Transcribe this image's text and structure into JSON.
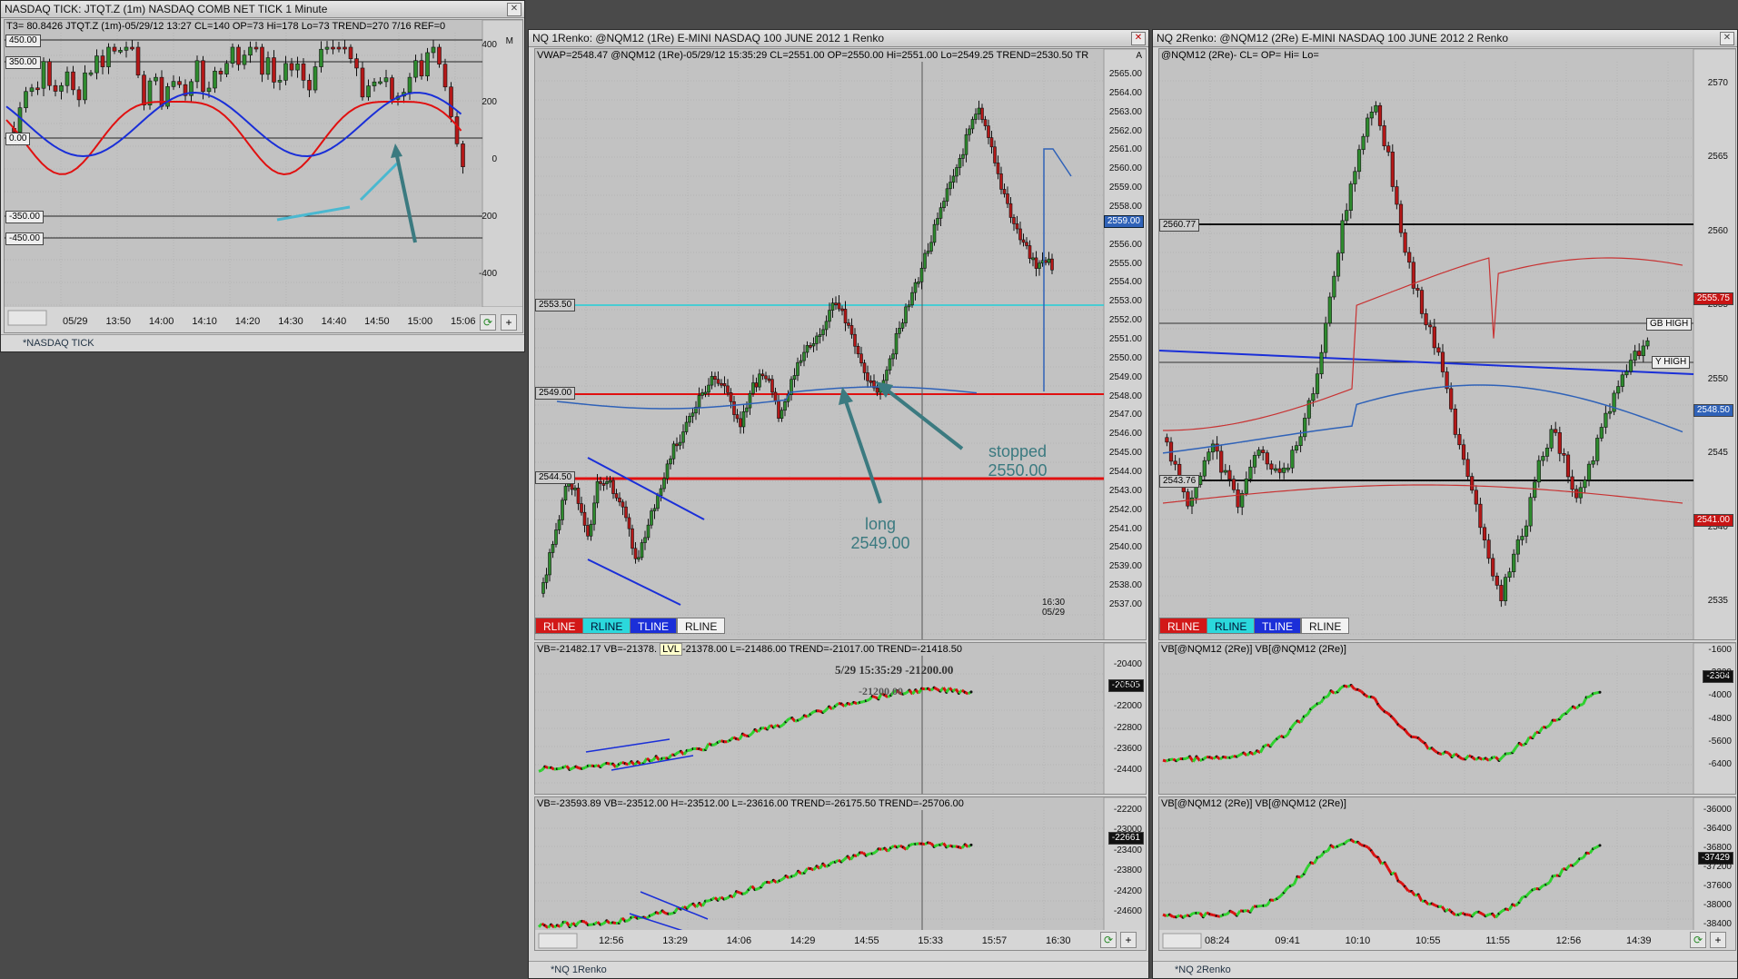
{
  "win1": {
    "title": "NASDAQ TICK: JTQT.Z (1m) NASDAQ COMB NET TICK 1 Minute",
    "header": "T3= 80.8426  JTQT.Z (1m)-05/29/12 13:27 CL=140 OP=73 Hi=178 Lo=73   TREND=270 7/16  REF=0",
    "corner_label": "M",
    "left_tags": [
      "450.00",
      "350.00",
      "0.00",
      "-350.00",
      "-450.00"
    ],
    "y_ticks": [
      "400",
      "200",
      "0",
      "-200",
      "-400"
    ],
    "x_ticks": [
      "05/29",
      "13:50",
      "14:00",
      "14:10",
      "14:20",
      "14:30",
      "14:40",
      "14:50",
      "15:00",
      "15:06"
    ],
    "tab": "*NASDAQ TICK"
  },
  "win2": {
    "title": "NQ 1Renko: @NQM12 (1Re) E-MINI NASDAQ 100 JUNE 2012 1 Renko",
    "header": "VWAP=2548.47   @NQM12 (1Re)-05/29/12 15:35:29 CL=2551.00 OP=2550.00 Hi=2551.00 Lo=2549.25   TREND=2530.50   TR",
    "corner_label": "A",
    "left_tags": [
      "2553.50",
      "2549.00",
      "2544.50"
    ],
    "price_tag": "2559.00",
    "y_ticks": [
      "2565.00",
      "2564.00",
      "2563.00",
      "2562.00",
      "2561.00",
      "2560.00",
      "2559.00",
      "2558.00",
      "2557.00",
      "2556.00",
      "2555.00",
      "2554.00",
      "2553.00",
      "2552.00",
      "2551.00",
      "2550.00",
      "2549.00",
      "2548.00",
      "2547.00",
      "2546.00",
      "2545.00",
      "2544.00",
      "2543.00",
      "2542.00",
      "2541.00",
      "2540.00",
      "2539.00",
      "2538.00",
      "2537.00"
    ],
    "time_corner": [
      "16:30",
      "05/29"
    ],
    "chips": [
      "RLINE",
      "RLINE",
      "TLINE",
      "RLINE"
    ],
    "ann_long": [
      "long",
      "2549.00"
    ],
    "ann_stopped": [
      "stopped",
      "2550.00"
    ],
    "sub1_header": "VB=-21482.17   VB=-21378.",
    "sub1_tooltip": "LVL",
    "sub1_header_rest": "-21378.00 L=-21486.00   TREND=-21017.00   TREND=-21418.50",
    "sub1_label": "5/29 15:35:29  -21200.00",
    "sub1_label2": "-21200.00",
    "sub1_tag": "-20505",
    "sub1_ticks": [
      "-20400",
      "-21200",
      "-22000",
      "-22800",
      "-23600",
      "-24400"
    ],
    "sub2_header": "VB=-23593.89   VB=-23512.00 H=-23512.00 L=-23616.00   TREND=-26175.50   TREND=-25706.00",
    "sub2_tag": "-22661",
    "sub2_ticks": [
      "-22200",
      "-23000",
      "-23400",
      "-23800",
      "-24200",
      "-24600"
    ],
    "x_ticks": [
      "12:56",
      "13:29",
      "14:06",
      "14:29",
      "14:55",
      "15:33",
      "15:57",
      "16:30"
    ],
    "tab": "*NQ 1Renko"
  },
  "win3": {
    "title": "NQ 2Renko: @NQM12 (2Re) E-MINI NASDAQ 100 JUNE 2012 2 Renko",
    "header": "@NQM12 (2Re)- CL= OP= Hi= Lo=",
    "left_tags": [
      "2560.77",
      "2543.76"
    ],
    "right_tags": [
      "2555.75",
      "2548.50",
      "2541.00"
    ],
    "mid_labels": [
      "GB HIGH",
      "Y HIGH"
    ],
    "y_ticks": [
      "2570",
      "2565",
      "2560",
      "2555",
      "2550",
      "2545",
      "2540",
      "2535"
    ],
    "chips": [
      "RLINE",
      "RLINE",
      "TLINE",
      "RLINE"
    ],
    "sub1_header": "VB[@NQM12 (2Re)]   VB[@NQM12 (2Re)]",
    "sub1_tag": "-2304",
    "sub1_ticks": [
      "-1600",
      "-3200",
      "-4000",
      "-4800",
      "-5600",
      "-6400"
    ],
    "sub2_header": "VB[@NQM12 (2Re)]   VB[@NQM12 (2Re)]",
    "sub2_tag": "-37429",
    "sub2_ticks": [
      "-36000",
      "-36400",
      "-36800",
      "-37200",
      "-37600",
      "-38000",
      "-38400"
    ],
    "x_ticks": [
      "08:24",
      "09:41",
      "10:10",
      "10:55",
      "11:55",
      "12:56",
      "14:39"
    ],
    "tab": "*NQ 2Renko"
  },
  "colors": {
    "up": "#2e8b2e",
    "down": "#b41818",
    "vwap": "#2f62b8",
    "ma_red": "#e01010",
    "ma_blue": "#1a2fd8",
    "cyan": "#21d0d8"
  }
}
